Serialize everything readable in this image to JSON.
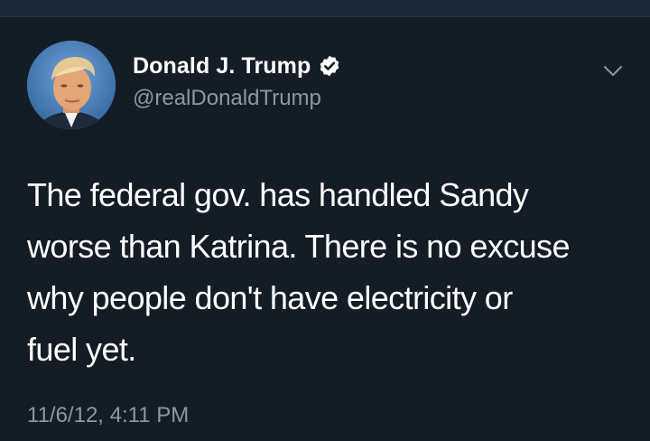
{
  "tweet": {
    "author": {
      "display_name": "Donald J. Trump",
      "handle": "@realDonaldTrump",
      "verified": true,
      "avatar_icon": "profile-photo"
    },
    "text": "The federal gov. has handled Sandy\nworse than Katrina. There is no excuse\nwhy people don't have electricity or\nfuel yet.",
    "timestamp": "11/6/12, 4:11 PM",
    "menu_icon": "chevron-down-icon"
  },
  "colors": {
    "background": "#141d26",
    "top_bar": "#1b2836",
    "primary_text": "#ffffff",
    "secondary_text": "#8899a6",
    "verified_badge": "#ffffff"
  }
}
